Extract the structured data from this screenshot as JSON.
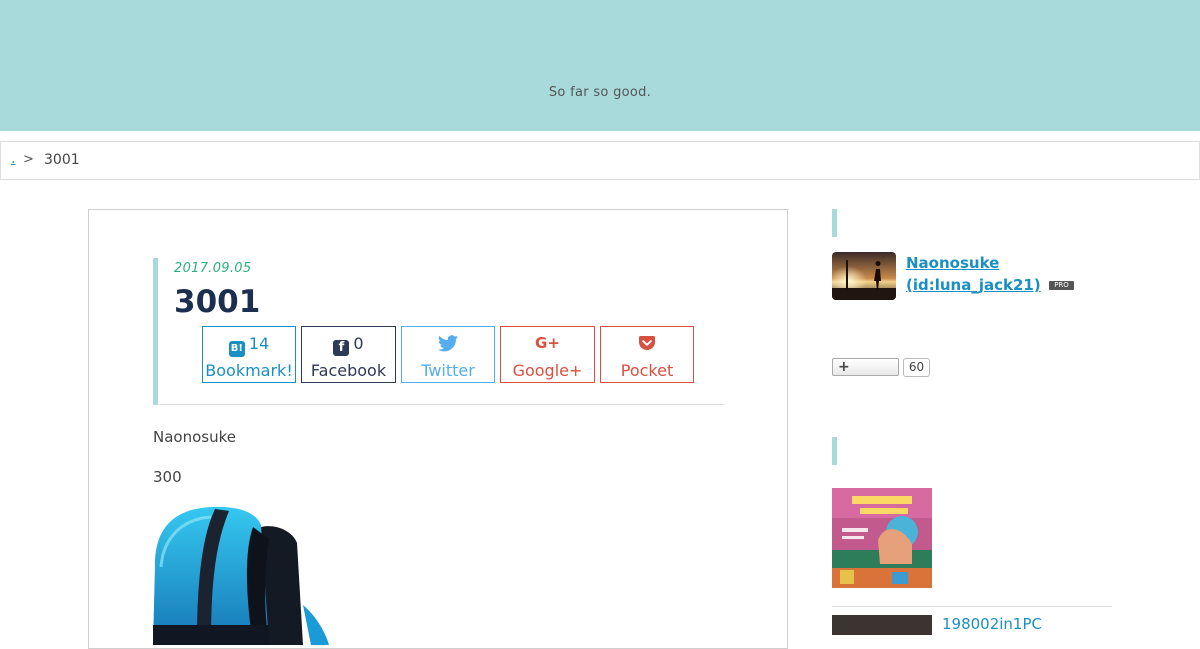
{
  "header": {
    "tagline": "So far so good."
  },
  "breadcrumb": {
    "home": ".",
    "separator": ">",
    "current": "3001"
  },
  "entry": {
    "date": "2017.09.05",
    "title": "3001",
    "share": {
      "hatena": {
        "icon": "B!",
        "count": "14",
        "label": "Bookmark!"
      },
      "facebook": {
        "icon": "f",
        "count": "0",
        "label": "Facebook"
      },
      "twitter": {
        "label": "Twitter"
      },
      "googleplus": {
        "icon": "G+",
        "label": "Google+"
      },
      "pocket": {
        "label": "Pocket"
      }
    },
    "body": {
      "author": "Naonosuke",
      "number": "300"
    }
  },
  "sidebar": {
    "profile": {
      "name": "Naonosuke",
      "id": "(id:luna_jack21)",
      "badge": "PRO"
    },
    "star": {
      "button": "+",
      "count": "60"
    },
    "related": [
      {
        "title": "198002in1PC"
      }
    ]
  },
  "colors": {
    "header_bg": "#a9dadb",
    "accent_link": "#1a8fc3",
    "date_green": "#2ab17c",
    "title_navy": "#1c2f4f",
    "facebook": "#2d3a57",
    "twitter": "#55acee",
    "red": "#d8503f"
  }
}
